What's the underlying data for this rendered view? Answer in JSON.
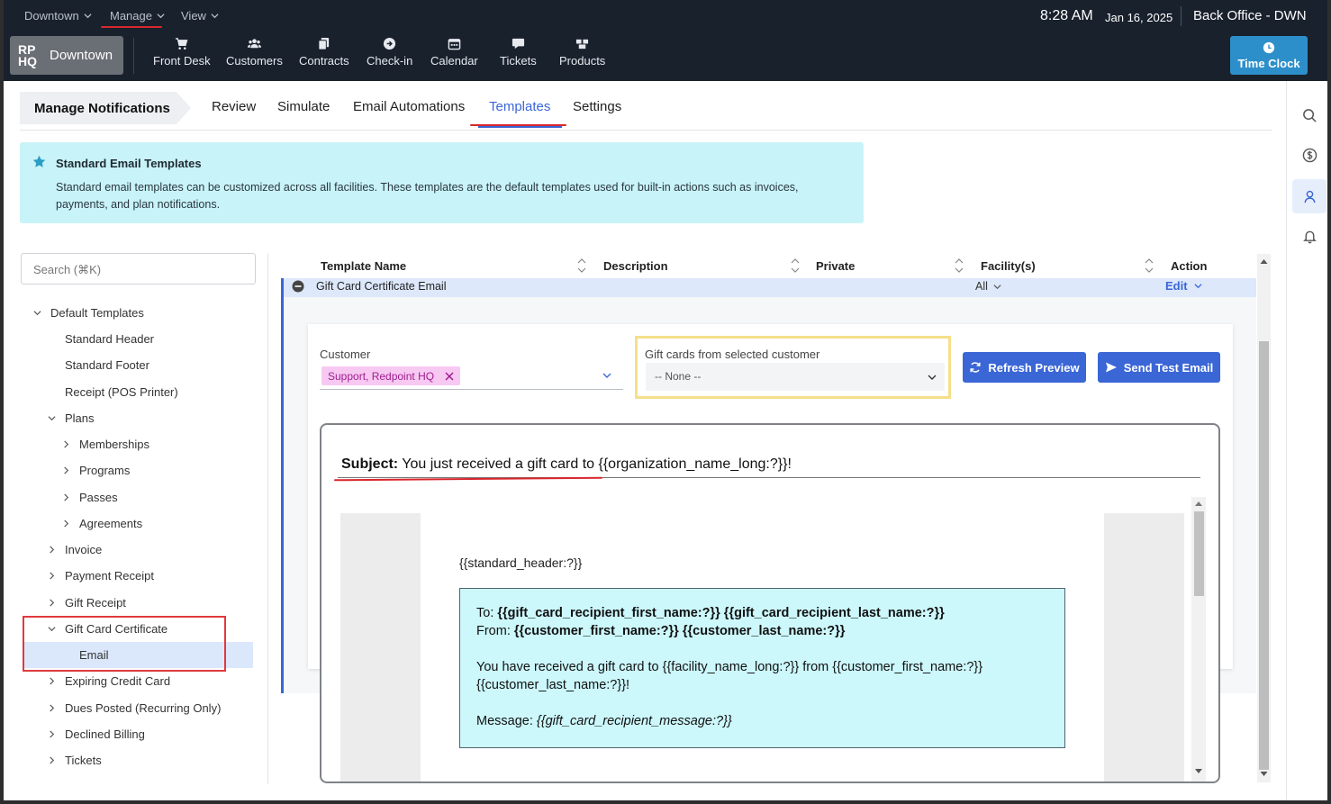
{
  "topbar": {
    "menus": [
      "Downtown",
      "Manage",
      "View"
    ],
    "time": "8:28 AM",
    "date": "Jan 16, 2025",
    "location": "Back Office - DWN"
  },
  "navbar": {
    "logo_mark": "RP HQ",
    "logo_text": "Downtown",
    "items": [
      "Front Desk",
      "Customers",
      "Contracts",
      "Check-in",
      "Calendar",
      "Tickets",
      "Products"
    ],
    "time_clock": "Time Clock"
  },
  "subnav": {
    "title": "Manage Notifications",
    "tabs": [
      "Review",
      "Simulate",
      "Email Automations",
      "Templates",
      "Settings"
    ],
    "active_tab": "Templates"
  },
  "info": {
    "title": "Standard Email Templates",
    "body": "Standard email templates can be customized across all facilities. These templates are the default templates used for built-in actions such as invoices, payments, and plan notifications."
  },
  "search": {
    "placeholder": "Search (⌘K)"
  },
  "tree": {
    "root": "Default Templates",
    "items": [
      "Standard Header",
      "Standard Footer",
      "Receipt (POS Printer)",
      "Plans",
      "Memberships",
      "Programs",
      "Passes",
      "Agreements",
      "Invoice",
      "Payment Receipt",
      "Gift Receipt",
      "Gift Card Certificate",
      "Email",
      "Expiring Credit Card",
      "Dues Posted (Recurring Only)",
      "Declined Billing",
      "Tickets"
    ]
  },
  "table": {
    "headers": [
      "Template Name",
      "Description",
      "Private",
      "Facility(s)",
      "Action"
    ],
    "row": {
      "name": "Gift Card Certificate Email",
      "facility": "All",
      "action": "Edit"
    }
  },
  "preview": {
    "customer_label": "Customer",
    "customer_chip": "Support, Redpoint HQ",
    "gift_label": "Gift cards from selected customer",
    "gift_value": "-- None --",
    "refresh_button": "Refresh Preview",
    "send_button": "Send Test Email",
    "subject_label": "Subject:",
    "subject_text": "You just received a gift card to {{organization_name_long:?}}!",
    "std_header": "{{standard_header:?}}",
    "to_label": "To:",
    "to_value": "{{gift_card_recipient_first_name:?}} {{gift_card_recipient_last_name:?}}",
    "from_label": "From:",
    "from_value": "{{customer_first_name:?}} {{customer_last_name:?}}",
    "body_line": "You have received a gift card to {{facility_name_long:?}} from {{customer_first_name:?}} {{customer_last_name:?}}!",
    "message_label": "Message:",
    "message_value": "{{gift_card_recipient_message:?}}"
  },
  "colors": {
    "topbar": "#19212d",
    "accent": "#3a66d6",
    "info_bg": "#c8f3f8",
    "chip_bg": "#f7c9f2",
    "annotation": "#d9262c",
    "highlight_box": "#f5df8a"
  }
}
